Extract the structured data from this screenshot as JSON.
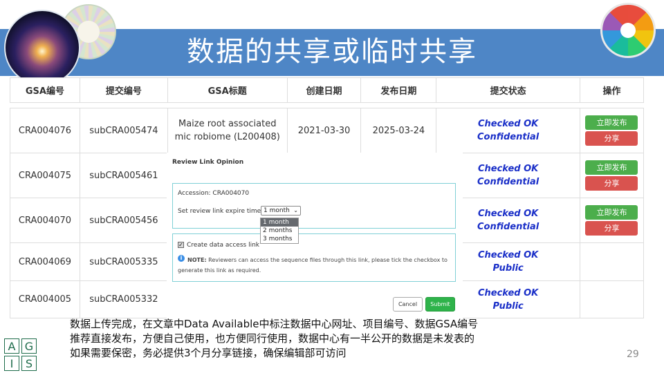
{
  "slide": {
    "title": "数据的共享或临时共享",
    "page_number": "29",
    "bottom_lines": [
      "数据上传完成，在文章中Data Available中标注数据中心网址、项目编号、数据GSA编号",
      "推荐直接发布，方便自己使用，也方便同行使用，数据中心有一半公开的数据是未发表的",
      "如果需要保密，务必提供3个月分享链接，确保编辑部可访问"
    ],
    "logo_letters": [
      "A",
      "G",
      "I",
      "S"
    ]
  },
  "table": {
    "headers": [
      "GSA编号",
      "提交编号",
      "GSA标题",
      "创建日期",
      "发布日期",
      "提交状态",
      "操作"
    ],
    "rows": [
      {
        "gsa": "CRA004076",
        "sub": "subCRA005474",
        "title": "Maize root associated mic robiome (L200408)",
        "created": "2021-03-30",
        "release": "2025-03-24",
        "status1": "Checked OK",
        "status2": "Confidential",
        "actions": true
      },
      {
        "gsa": "CRA004075",
        "sub": "subCRA005461",
        "title": "",
        "created": "",
        "release": "",
        "status1": "Checked OK",
        "status2": "Confidential",
        "actions": true
      },
      {
        "gsa": "CRA004070",
        "sub": "subCRA005456",
        "title": "",
        "created": "",
        "release": "",
        "status1": "Checked OK",
        "status2": "Confidential",
        "actions": true
      },
      {
        "gsa": "CRA004069",
        "sub": "subCRA005335",
        "title": "",
        "created": "",
        "release": "",
        "status1": "Checked OK",
        "status2": "Public",
        "actions": false
      },
      {
        "gsa": "CRA004005",
        "sub": "subCRA005332",
        "title": "",
        "created": "",
        "release": "",
        "status1": "Checked OK",
        "status2": "Public",
        "actions": false
      }
    ],
    "publish_label": "立即发布",
    "share_label": "分享"
  },
  "modal": {
    "title": "Review Link Opinion",
    "accession": "Accession: CRA004070",
    "expire_label": "Set review link expire time",
    "selected_option": "1 month",
    "options": [
      "1 month",
      "2 months",
      "3 months"
    ],
    "checkbox_label": "Create data access link",
    "checkbox_checked": true,
    "note_bold": "NOTE:",
    "note_text": " Reviewers can access the sequence files through this link, please tick the checkbox to generate this link as required.",
    "cancel_label": "Cancel",
    "submit_label": "Submit"
  }
}
